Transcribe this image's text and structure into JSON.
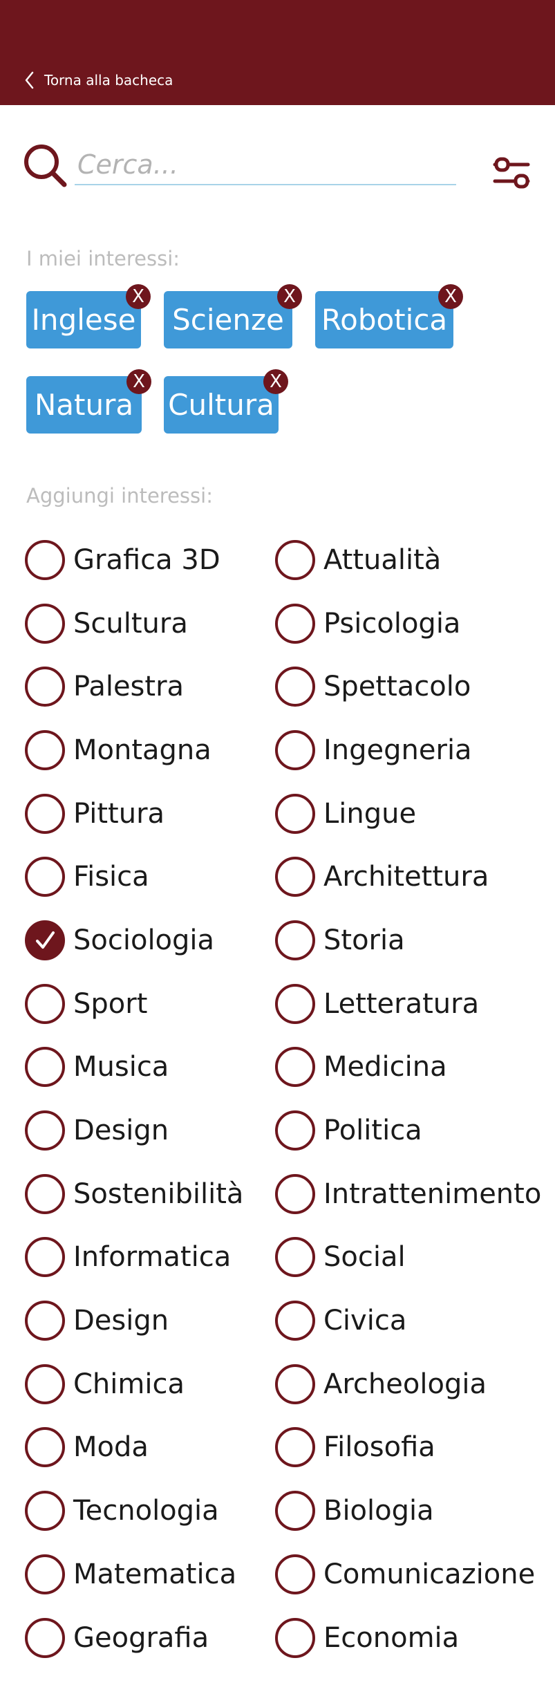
{
  "header": {
    "back_label": "Torna alla bacheca",
    "background": "#6e161d"
  },
  "search": {
    "placeholder": "Cerca...",
    "value": ""
  },
  "my_interests": {
    "label": "I miei interessi:",
    "chips": [
      {
        "label": "Inglese",
        "remove": "X"
      },
      {
        "label": "Scienze",
        "remove": "X"
      },
      {
        "label": "Robotica",
        "remove": "X"
      },
      {
        "label": "Natura",
        "remove": "X"
      },
      {
        "label": "Cultura",
        "remove": "X"
      }
    ],
    "chip_color": "#3f99d8"
  },
  "add_interests": {
    "label": "Aggiungi interessi:",
    "items": [
      {
        "label": "Grafica 3D",
        "checked": false
      },
      {
        "label": "Attualità",
        "checked": false
      },
      {
        "label": "Scultura",
        "checked": false
      },
      {
        "label": "Psicologia",
        "checked": false
      },
      {
        "label": "Palestra",
        "checked": false
      },
      {
        "label": "Spettacolo",
        "checked": false
      },
      {
        "label": "Montagna",
        "checked": false
      },
      {
        "label": "Ingegneria",
        "checked": false
      },
      {
        "label": "Pittura",
        "checked": false
      },
      {
        "label": "Lingue",
        "checked": false
      },
      {
        "label": "Fisica",
        "checked": false
      },
      {
        "label": "Architettura",
        "checked": false
      },
      {
        "label": "Sociologia",
        "checked": true
      },
      {
        "label": "Storia",
        "checked": false
      },
      {
        "label": "Sport",
        "checked": false
      },
      {
        "label": "Letteratura",
        "checked": false
      },
      {
        "label": "Musica",
        "checked": false
      },
      {
        "label": "Medicina",
        "checked": false
      },
      {
        "label": "Design",
        "checked": false
      },
      {
        "label": "Politica",
        "checked": false
      },
      {
        "label": "Sostenibilità",
        "checked": false
      },
      {
        "label": "Intrattenimento",
        "checked": false
      },
      {
        "label": "Informatica",
        "checked": false
      },
      {
        "label": "Social",
        "checked": false
      },
      {
        "label": "Design",
        "checked": false
      },
      {
        "label": "Civica",
        "checked": false
      },
      {
        "label": "Chimica",
        "checked": false
      },
      {
        "label": "Archeologia",
        "checked": false
      },
      {
        "label": "Moda",
        "checked": false
      },
      {
        "label": "Filosofia",
        "checked": false
      },
      {
        "label": "Tecnologia",
        "checked": false
      },
      {
        "label": "Biologia",
        "checked": false
      },
      {
        "label": "Matematica",
        "checked": false
      },
      {
        "label": "Comunicazione",
        "checked": false
      },
      {
        "label": "Geografia",
        "checked": false
      },
      {
        "label": "Economia",
        "checked": false
      }
    ],
    "accent": "#6e161d"
  },
  "icons": {
    "back": "chevron-left-icon",
    "search": "search-icon",
    "filter": "filter-sliders-icon",
    "remove": "close-icon",
    "check": "check-icon"
  }
}
